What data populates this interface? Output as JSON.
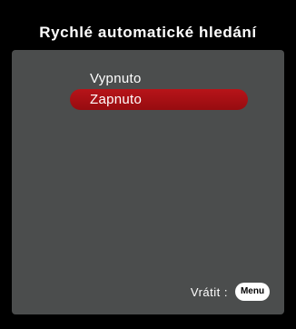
{
  "osd": {
    "title": "Rychlé automatické hledání",
    "options": [
      {
        "label": "Vypnuto",
        "selected": false
      },
      {
        "label": "Zapnuto",
        "selected": true
      }
    ],
    "footer": {
      "back_label": "Vrátit :",
      "menu_key": "Menu"
    }
  },
  "colors": {
    "background": "#000000",
    "panel": "#4b4d4d",
    "highlight": "#a50f13",
    "text": "#ffffff"
  }
}
